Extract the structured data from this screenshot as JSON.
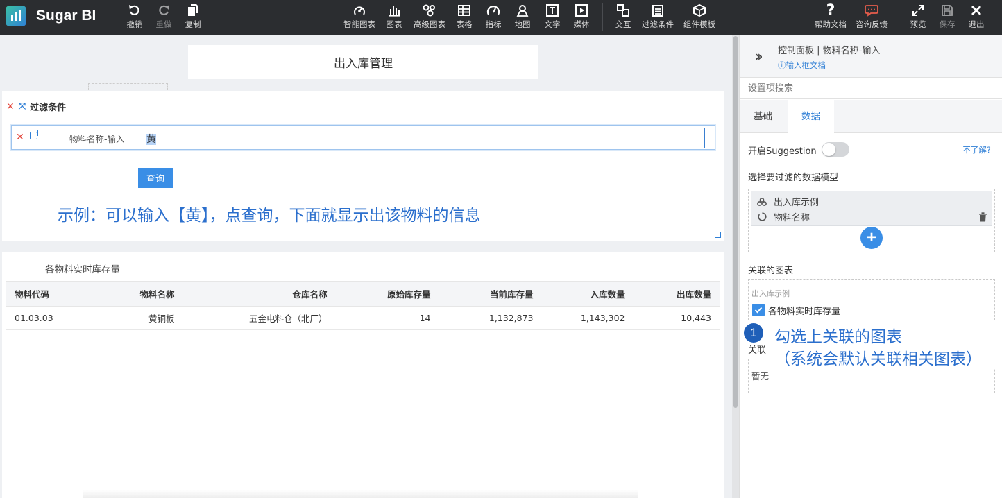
{
  "app": {
    "name": "Sugar BI"
  },
  "toolbar": {
    "left": [
      {
        "label": "撤销",
        "icon": "undo-icon"
      },
      {
        "label": "重做",
        "icon": "redo-icon"
      },
      {
        "label": "复制",
        "icon": "copy-icon"
      }
    ],
    "center": [
      {
        "label": "智能图表",
        "icon": "smart-chart-icon"
      },
      {
        "label": "图表",
        "icon": "bar-chart-icon"
      },
      {
        "label": "高级图表",
        "icon": "advanced-chart-icon"
      },
      {
        "label": "表格",
        "icon": "table-icon"
      },
      {
        "label": "指标",
        "icon": "gauge-icon"
      },
      {
        "label": "地图",
        "icon": "map-pin-icon"
      },
      {
        "label": "文字",
        "icon": "text-icon"
      },
      {
        "label": "媒体",
        "icon": "media-icon"
      },
      {
        "label": "交互",
        "icon": "interaction-icon"
      },
      {
        "label": "过滤条件",
        "icon": "filter-icon"
      },
      {
        "label": "组件模板",
        "icon": "template-icon"
      }
    ],
    "right": [
      {
        "label": "帮助文档",
        "icon": "help-icon"
      },
      {
        "label": "咨询反馈",
        "icon": "feedback-icon"
      },
      {
        "label": "预览",
        "icon": "expand-icon"
      },
      {
        "label": "保存",
        "icon": "save-icon"
      },
      {
        "label": "退出",
        "icon": "close-icon"
      }
    ]
  },
  "canvas": {
    "title": "出入库管理",
    "filter": {
      "header": "过滤条件",
      "row_label": "物料名称-输入",
      "input_value": "黄",
      "query_button": "查询"
    },
    "annotation": "示例：可以输入【黄】，点查询，下面就显示出该物料的信息",
    "table": {
      "title": "各物料实时库存量",
      "columns": [
        "物料代码",
        "物料名称",
        "仓库名称",
        "原始库存量",
        "当前库存量",
        "入库数量",
        "出库数量"
      ],
      "rows": [
        [
          "01.03.03",
          "黄铜板",
          "五金电料仓（北厂）",
          "14",
          "1,132,873",
          "1,143,302",
          "10,443"
        ]
      ]
    }
  },
  "panel": {
    "title": "控制面板 | 物料名称-输入",
    "doc_link": "输入框文档",
    "search_placeholder": "设置项搜索",
    "tabs": [
      "基础",
      "数据"
    ],
    "active_tab": "数据",
    "suggestion_label": "开启Suggestion",
    "suggestion_on": false,
    "help_link": "不了解?",
    "model_section_label": "选择要过滤的数据模型",
    "model": {
      "dataset": "出入库示例",
      "field": "物料名称"
    },
    "linked_section_label": "关联的图表",
    "linked_group": "出入库示例",
    "linked_chart": "各物料实时库存量",
    "linked_checked": true,
    "assoc_section_label": "关联",
    "assoc_empty": "暂无"
  },
  "callout": {
    "number": "1",
    "line1": "勾选上关联的图表",
    "line2": "（系统会默认关联相关图表）"
  },
  "colors": {
    "toolbar_bg": "#2b2d30",
    "accent_blue": "#3a8ee6",
    "annotation_blue": "#2b6fcd",
    "delete_red": "#e2463c"
  }
}
